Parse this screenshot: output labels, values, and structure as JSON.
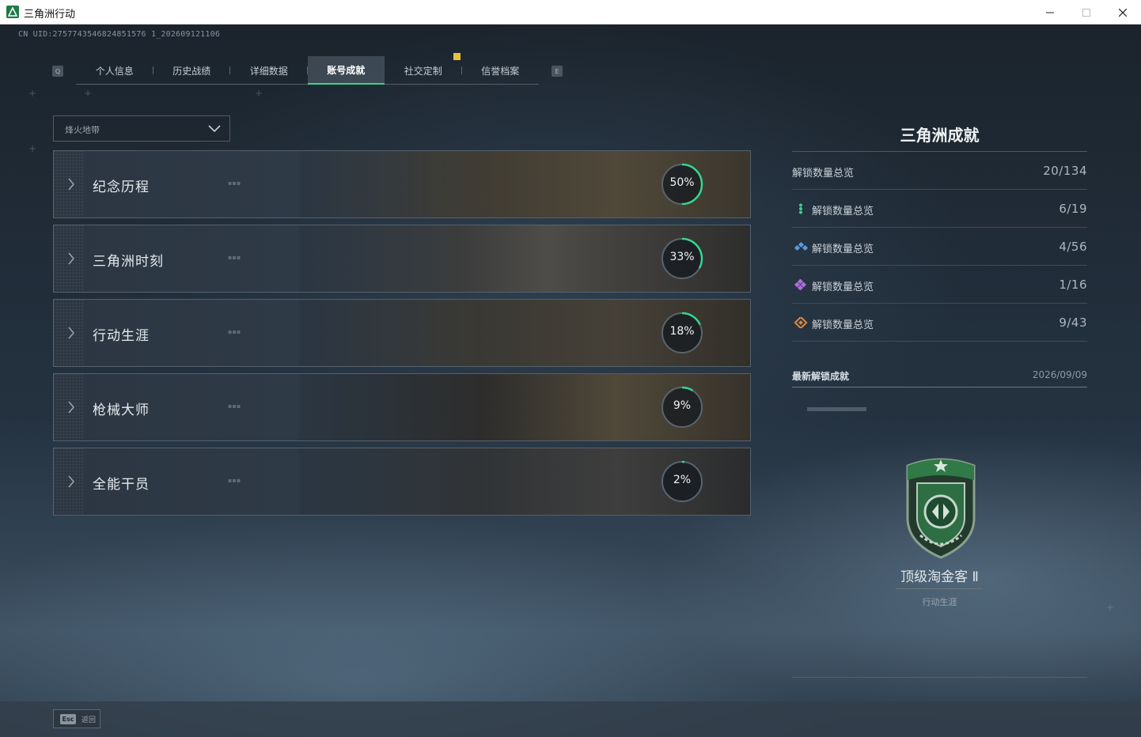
{
  "window": {
    "title": "三角洲行动"
  },
  "uid": "CN UID:2757743546824851576 1_202609121106",
  "tabs": {
    "left_key": "Q",
    "right_key": "E",
    "items": [
      {
        "label": "个人信息",
        "active": false
      },
      {
        "label": "历史战绩",
        "active": false
      },
      {
        "label": "详细数据",
        "active": false
      },
      {
        "label": "账号成就",
        "active": true
      },
      {
        "label": "社交定制",
        "active": false
      },
      {
        "label": "信誉档案",
        "active": false
      }
    ]
  },
  "filter": {
    "selected": "烽火地带"
  },
  "categories": [
    {
      "name": "纪念历程",
      "progress_text": "50%",
      "progress": 0.5
    },
    {
      "name": "三角洲时刻",
      "progress_text": "33%",
      "progress": 0.33
    },
    {
      "name": "行动生涯",
      "progress_text": "18%",
      "progress": 0.18
    },
    {
      "name": "枪械大师",
      "progress_text": "9%",
      "progress": 0.09
    },
    {
      "name": "全能干员",
      "progress_text": "2%",
      "progress": 0.02
    }
  ],
  "panel": {
    "title": "三角洲成就",
    "total": {
      "label": "解锁数量总览",
      "value": "20/134"
    },
    "tiers": [
      {
        "label": "解锁数量总览",
        "value": "6/19",
        "icon": "green-tier-icon",
        "color": "#3ecf8e"
      },
      {
        "label": "解锁数量总览",
        "value": "4/56",
        "icon": "blue-tier-icon",
        "color": "#5b9be0"
      },
      {
        "label": "解锁数量总览",
        "value": "1/16",
        "icon": "purple-tier-icon",
        "color": "#b06be0"
      },
      {
        "label": "解锁数量总览",
        "value": "9/43",
        "icon": "gold-tier-icon",
        "color": "#e0893e"
      }
    ],
    "latest_label": "最新解锁成就",
    "latest_date": "2026/09/09",
    "badge_name": "顶级淘金客 Ⅱ",
    "badge_category": "行动生涯"
  },
  "footer": {
    "esc_key": "Esc",
    "back_label": "返回"
  },
  "colors": {
    "accent": "#36d68f",
    "marker": "#e8c23a"
  }
}
